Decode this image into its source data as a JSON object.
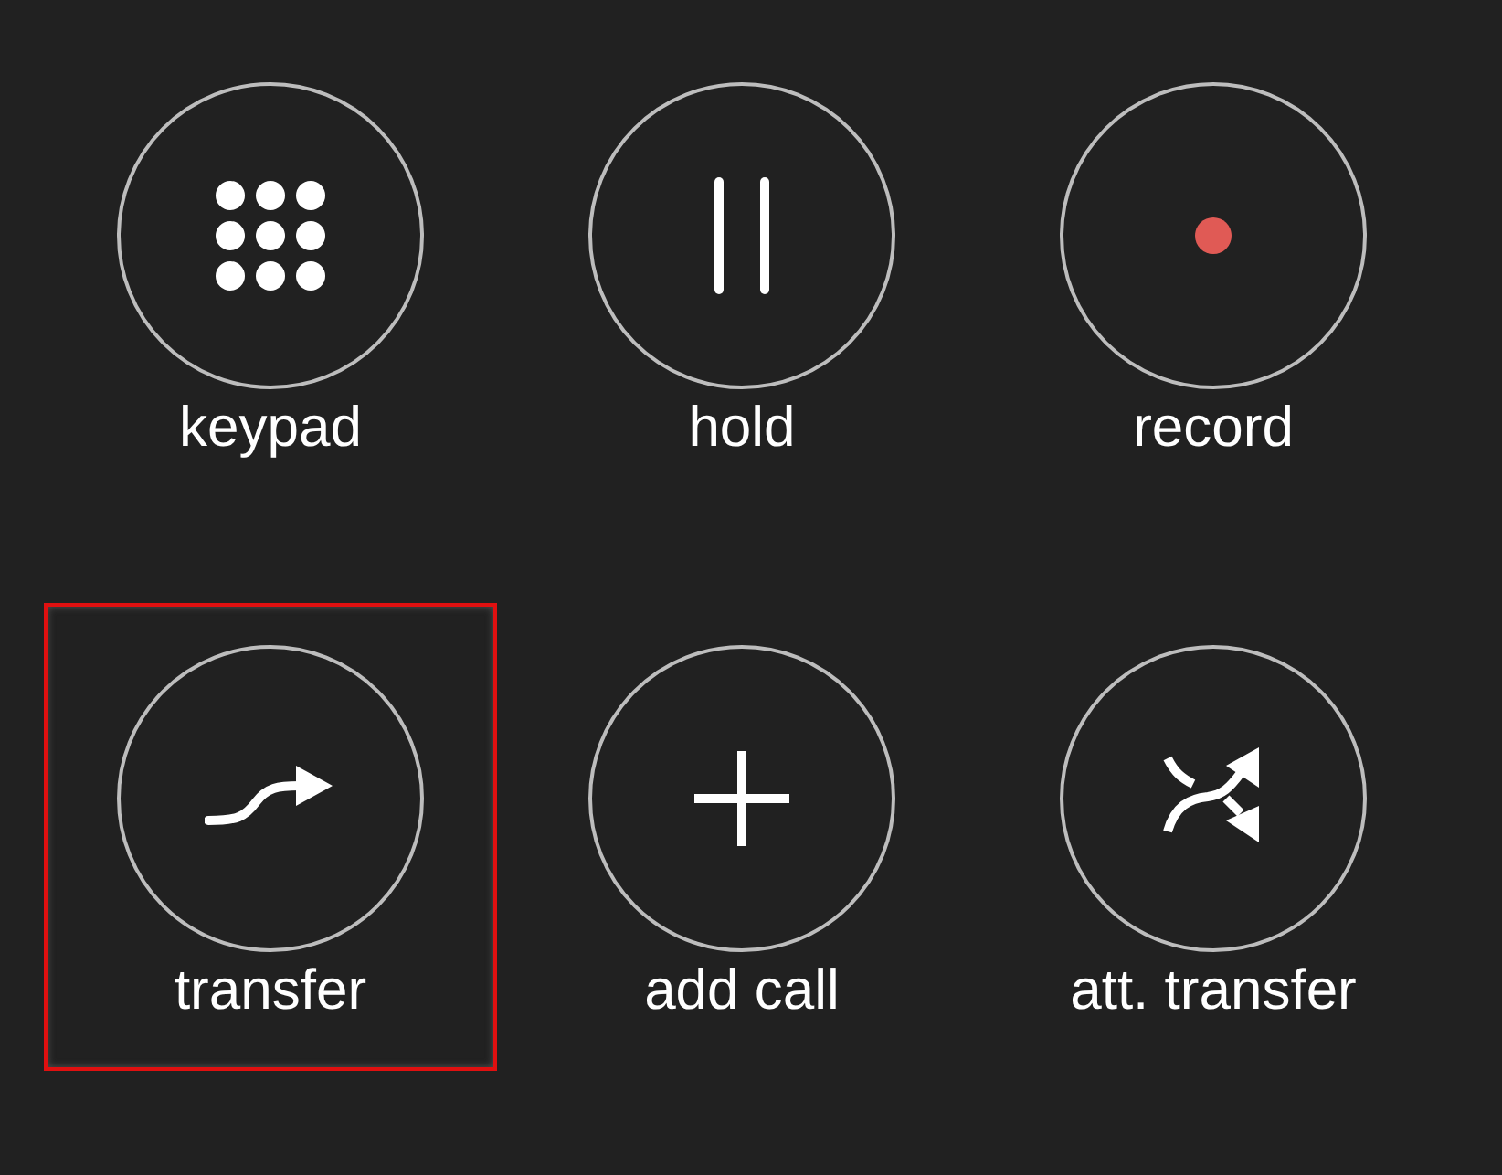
{
  "buttons": [
    {
      "kind": "keypad",
      "label": "keypad",
      "selected": false
    },
    {
      "kind": "hold",
      "label": "hold",
      "selected": false
    },
    {
      "kind": "record",
      "label": "record",
      "selected": false
    },
    {
      "kind": "transfer",
      "label": "transfer",
      "selected": true
    },
    {
      "kind": "add",
      "label": "add call",
      "selected": false
    },
    {
      "kind": "attended",
      "label": "att. transfer",
      "selected": false
    }
  ]
}
